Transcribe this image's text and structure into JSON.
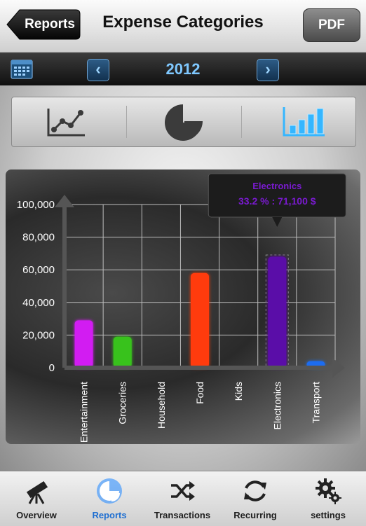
{
  "nav": {
    "back_label": "Reports",
    "title": "Expense Categories",
    "pdf_label": "PDF"
  },
  "year_bar": {
    "year": "2012",
    "calendar_icon": "calendar-icon",
    "prev_icon": "chevron-left-icon",
    "next_icon": "chevron-right-icon"
  },
  "view_modes": [
    {
      "name": "line-chart-mode",
      "icon": "line-chart-icon",
      "selected": false
    },
    {
      "name": "pie-chart-mode",
      "icon": "pie-chart-icon",
      "selected": false
    },
    {
      "name": "bar-chart-mode",
      "icon": "bar-chart-icon",
      "selected": true
    }
  ],
  "chart_data": {
    "type": "bar",
    "categories": [
      "Entertainment",
      "Groceries",
      "Household",
      "Food",
      "Kids",
      "Electronics",
      "Transport"
    ],
    "values": [
      29000,
      19000,
      0,
      58000,
      0,
      68000,
      4000
    ],
    "colors": [
      "#d21bf2",
      "#39c21a",
      "#1aa6a6",
      "#ff3a10",
      "#a020c0",
      "#5a0aa8",
      "#1a6cf0"
    ],
    "yticks": [
      "0",
      "20,000",
      "40,000",
      "60,000",
      "80,000",
      "100,000"
    ],
    "ylim": [
      0,
      100000
    ],
    "grid": true,
    "selected_index": 5,
    "tooltip": {
      "title": "Electronics",
      "text": "33.2 % : 71,100 $"
    }
  },
  "tabs": [
    {
      "label": "Overview",
      "icon": "telescope-icon",
      "active": false
    },
    {
      "label": "Reports",
      "icon": "reports-pie-icon",
      "active": true
    },
    {
      "label": "Transactions",
      "icon": "shuffle-icon",
      "active": false
    },
    {
      "label": "Recurring",
      "icon": "refresh-icon",
      "active": false
    },
    {
      "label": "settings",
      "icon": "gears-icon",
      "active": false
    }
  ]
}
